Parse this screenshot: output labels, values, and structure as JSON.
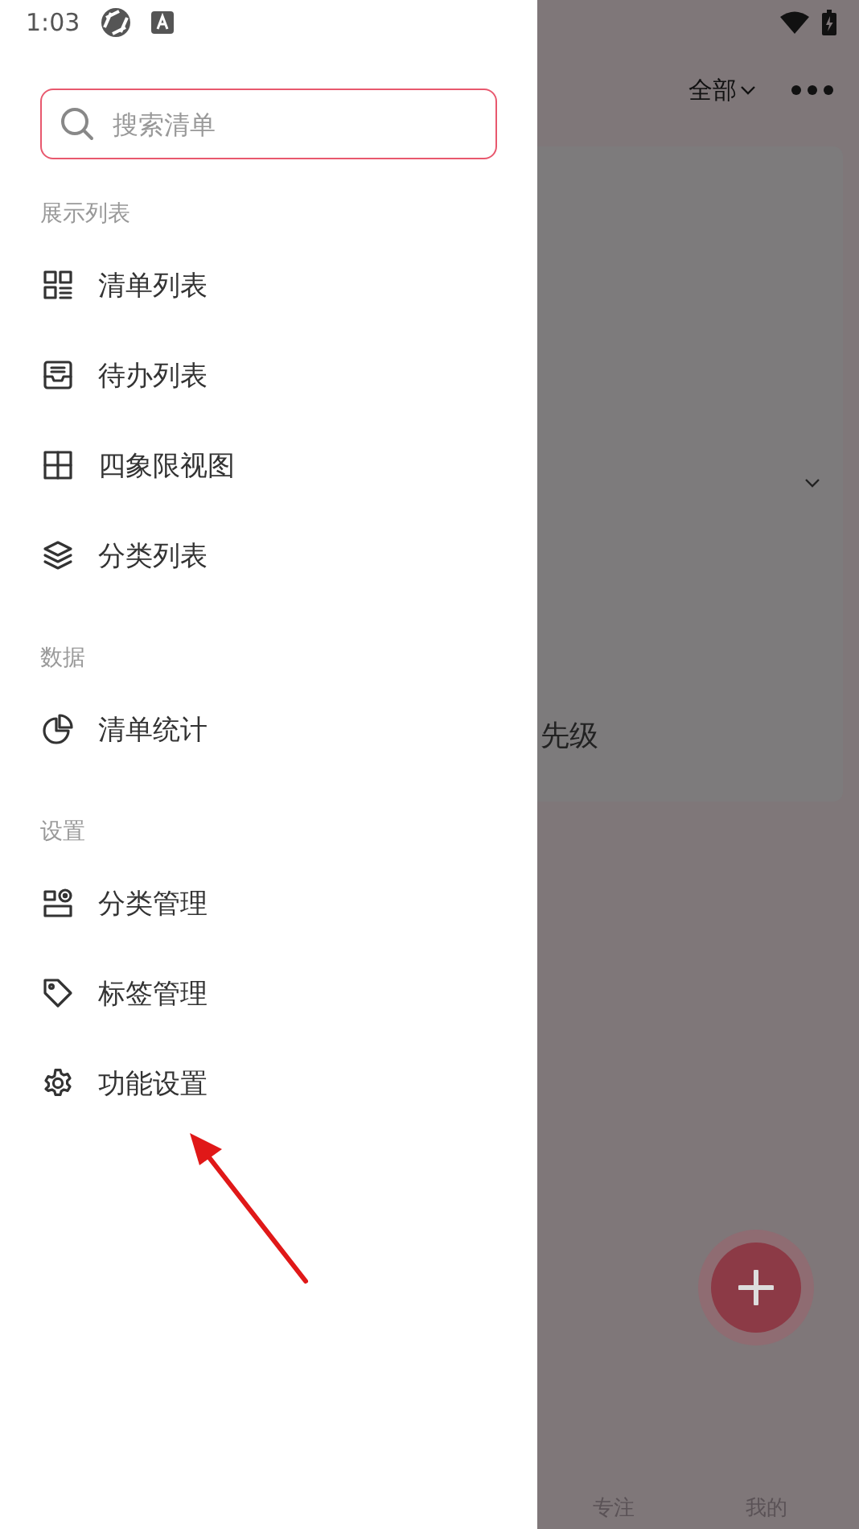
{
  "status_bar": {
    "time": "1:03"
  },
  "drawer": {
    "search": {
      "placeholder": "搜索清单"
    },
    "sections": [
      {
        "title": "展示列表",
        "items": [
          {
            "label": "清单列表"
          },
          {
            "label": "待办列表"
          },
          {
            "label": "四象限视图"
          },
          {
            "label": "分类列表"
          }
        ]
      },
      {
        "title": "数据",
        "items": [
          {
            "label": "清单统计"
          }
        ]
      },
      {
        "title": "设置",
        "items": [
          {
            "label": "分类管理"
          },
          {
            "label": "标签管理"
          },
          {
            "label": "功能设置"
          }
        ]
      }
    ]
  },
  "background_screen": {
    "filter": "全部",
    "card_text": "先级",
    "nav": [
      "专注",
      "我的"
    ]
  }
}
